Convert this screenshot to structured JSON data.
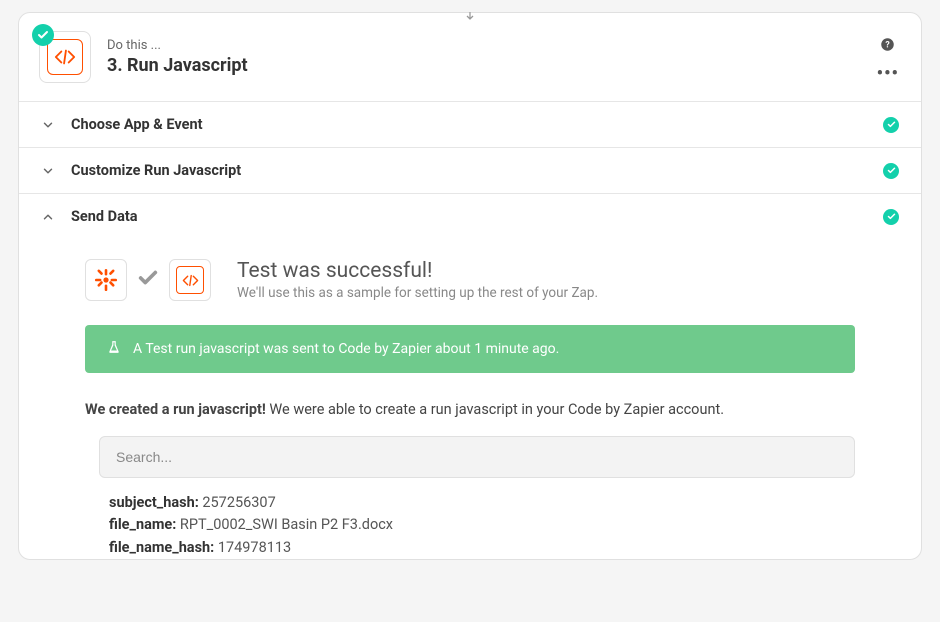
{
  "arrow": "▼",
  "header": {
    "subtitle": "Do this ...",
    "title": "3. Run Javascript"
  },
  "sections": {
    "choose": "Choose App & Event",
    "customize": "Customize Run Javascript",
    "send": "Send Data"
  },
  "testSuccess": {
    "heading": "Test was successful!",
    "sub": "We'll use this as a sample for setting up the rest of your Zap."
  },
  "banner": "A Test run javascript was sent to Code by Zapier about 1 minute ago.",
  "created": {
    "bold": "We created a run javascript!",
    "rest": " We were able to create a run javascript in your Code by Zapier account."
  },
  "search": {
    "placeholder": "Search..."
  },
  "results": [
    {
      "key": "subject_hash:",
      "val": " 257256307"
    },
    {
      "key": "file_name:",
      "val": " RPT_0002_SWI Basin P2 F3.docx"
    },
    {
      "key": "file_name_hash:",
      "val": " 174978113"
    }
  ]
}
